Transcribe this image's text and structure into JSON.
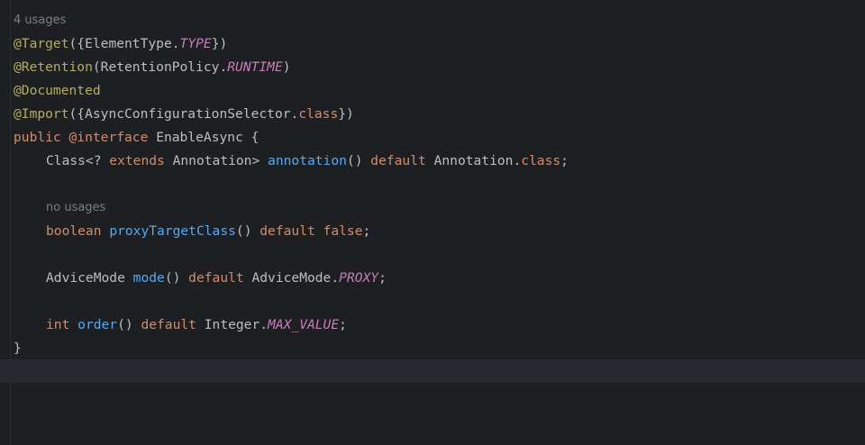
{
  "editor": {
    "usage_hint": "4 usages",
    "line_target": {
      "annotation": "@Target",
      "open": "({ElementType.",
      "constant": "TYPE",
      "close": "})"
    },
    "line_retention": {
      "annotation": "@Retention",
      "open": "(RetentionPolicy.",
      "constant": "RUNTIME",
      "close": ")"
    },
    "line_documented": {
      "annotation": "@Documented"
    },
    "line_import": {
      "annotation": "@Import",
      "open": "({AsyncConfigurationSelector.",
      "kw_class": "class",
      "close": "})"
    },
    "line_decl": {
      "kw_public": "public",
      "kw_interface": "@interface",
      "name": "EnableAsync {"
    },
    "line_annotation_method": {
      "type_open": "Class<? ",
      "kw_extends": "extends",
      "type_close": " Annotation> ",
      "method": "annotation",
      "parens": "() ",
      "kw_default": "default",
      "value_prefix": " Annotation.",
      "kw_class": "class",
      "end": ";"
    },
    "member_hint": "no usages",
    "line_proxy_method": {
      "kw_type": "boolean",
      "method": "proxyTargetClass",
      "parens": "() ",
      "kw_default": "default",
      "kw_value": "false",
      "end": ";"
    },
    "line_mode_method": {
      "type": "AdviceMode ",
      "method": "mode",
      "parens": "() ",
      "kw_default": "default",
      "value_prefix": " AdviceMode.",
      "constant": "PROXY",
      "end": ";"
    },
    "line_order_method": {
      "kw_type": "int",
      "method": "order",
      "parens": "() ",
      "kw_default": "default",
      "value_prefix": " Integer.",
      "constant": "MAX_VALUE",
      "end": ";"
    },
    "closing_brace": "}"
  },
  "colors": {
    "background": "#1e1f22",
    "annotation": "#b3ae60",
    "keyword": "#cf8e6d",
    "method": "#56a8f5",
    "constant": "#c77dbb",
    "text": "#bcbec4",
    "hint": "#7a7e85"
  }
}
